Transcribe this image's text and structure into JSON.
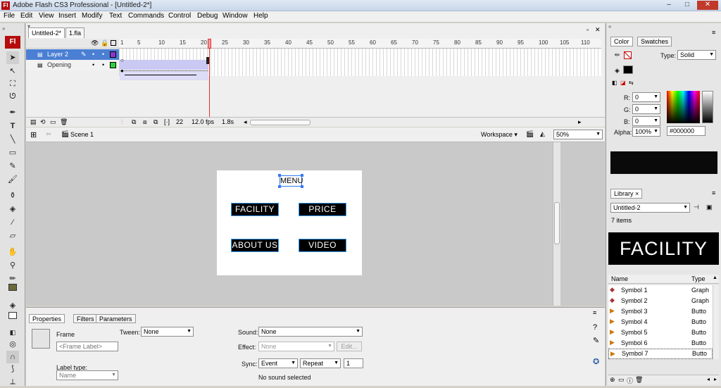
{
  "window": {
    "title": "Adobe Flash CS3 Professional - [Untitled-2*]",
    "app_icon": "Fl",
    "controls": [
      "–",
      "□",
      "✕"
    ]
  },
  "menu": [
    "File",
    "Edit",
    "View",
    "Insert",
    "Modify",
    "Text",
    "Commands",
    "Control",
    "Debug",
    "Window",
    "Help"
  ],
  "doc_tabs": [
    "Untitled-2*",
    "1.fla"
  ],
  "timeline": {
    "ticks": [
      "1",
      "5",
      "10",
      "15",
      "20",
      "25",
      "30",
      "35",
      "40",
      "45",
      "50",
      "55",
      "60",
      "65",
      "70",
      "75",
      "80",
      "85",
      "90",
      "95",
      "100",
      "105",
      "110"
    ],
    "layers": [
      {
        "name": "Layer 2",
        "selected": true,
        "color": "#8a37c9"
      },
      {
        "name": "Opening",
        "selected": false,
        "color": "#2fcf3f"
      }
    ],
    "current_frame": "22",
    "fps": "12.0 fps",
    "time": "1.8s"
  },
  "editbar": {
    "scene": "Scene 1",
    "workspace": "Workspace ▾",
    "zoom": "50%"
  },
  "stage": {
    "menu_label": "MENU",
    "buttons": [
      "FACILITY",
      "PRICE",
      "ABOUT US",
      "VIDEO"
    ]
  },
  "properties": {
    "tabs": [
      "Properties",
      "Filters",
      "Parameters"
    ],
    "frame_label": "Frame",
    "frame_placeholder": "<Frame Label>",
    "tween_label": "Tween:",
    "tween_value": "None",
    "sound_label": "Sound:",
    "sound_value": "None",
    "effect_label": "Effect:",
    "effect_value": "None",
    "edit_button": "Edit...",
    "sync_label": "Sync:",
    "sync_value": "Event",
    "repeat_value": "Repeat",
    "repeat_count": "1",
    "label_type_label": "Label type:",
    "label_type_value": "Name",
    "no_sound": "No sound selected"
  },
  "color_panel": {
    "tabs": [
      "Color",
      "Swatches"
    ],
    "type_label": "Type:",
    "type_value": "Solid",
    "r_label": "R:",
    "r": "0",
    "g_label": "G:",
    "g": "0",
    "b_label": "B:",
    "b": "0",
    "alpha_label": "Alpha:",
    "alpha": "100%",
    "hex": "#000000"
  },
  "library": {
    "tab": "Library",
    "doc": "Untitled-2",
    "count": "7 items",
    "preview": "FACILITY",
    "col_name": "Name",
    "col_type": "Type",
    "items": [
      {
        "name": "Symbol 1",
        "type": "Graph"
      },
      {
        "name": "Symbol 2",
        "type": "Graph"
      },
      {
        "name": "Symbol 3",
        "type": "Butto"
      },
      {
        "name": "Symbol 4",
        "type": "Butto"
      },
      {
        "name": "Symbol 5",
        "type": "Butto"
      },
      {
        "name": "Symbol 6",
        "type": "Butto"
      },
      {
        "name": "Symbol 7",
        "type": "Butto"
      }
    ]
  }
}
